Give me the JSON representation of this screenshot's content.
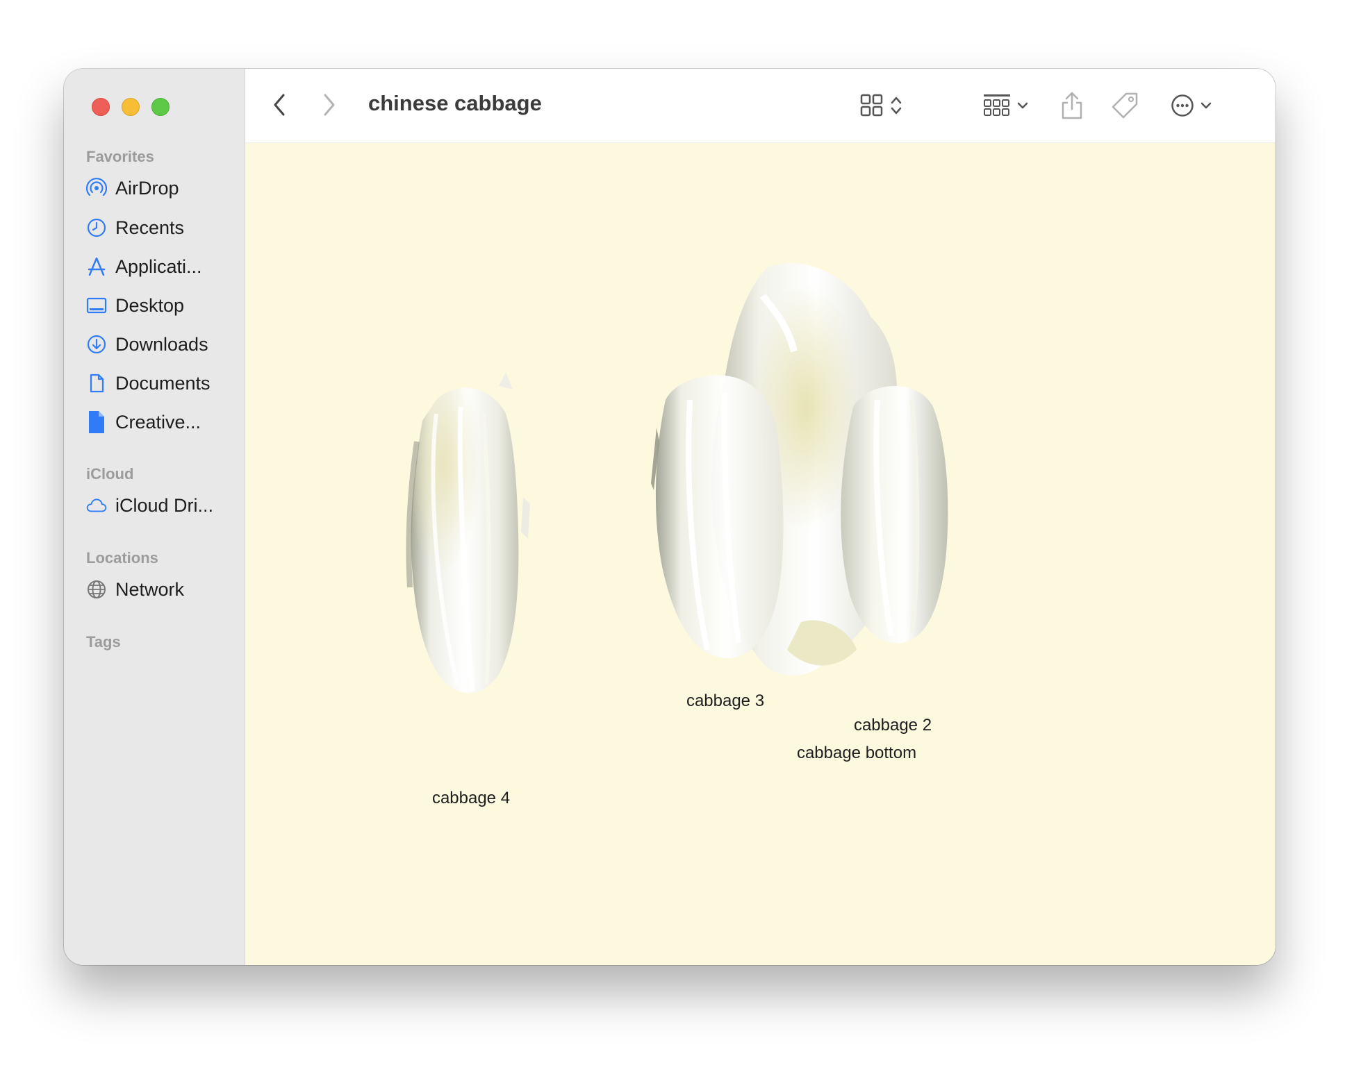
{
  "window": {
    "title": "chinese cabbage"
  },
  "sidebar": {
    "favorites_label": "Favorites",
    "favorites": [
      {
        "label": "AirDrop",
        "icon": "airdrop-icon"
      },
      {
        "label": "Recents",
        "icon": "clock-icon"
      },
      {
        "label": "Applicati...",
        "icon": "applications-icon"
      },
      {
        "label": "Desktop",
        "icon": "desktop-icon"
      },
      {
        "label": "Downloads",
        "icon": "download-icon"
      },
      {
        "label": "Documents",
        "icon": "document-icon"
      },
      {
        "label": "Creative...",
        "icon": "file-icon"
      }
    ],
    "icloud_label": "iCloud",
    "icloud": [
      {
        "label": "iCloud Dri...",
        "icon": "cloud-icon"
      }
    ],
    "locations_label": "Locations",
    "locations": [
      {
        "label": "Network",
        "icon": "globe-icon"
      }
    ],
    "tags_label": "Tags"
  },
  "files": [
    {
      "label": "cabbage 4"
    },
    {
      "label": "cabbage 3"
    },
    {
      "label": "cabbage 2"
    },
    {
      "label": "cabbage bottom"
    }
  ],
  "colors": {
    "accent": "#2f7cf6",
    "content_bg": "#fdf9df",
    "sidebar_bg": "#e8e8e8"
  }
}
